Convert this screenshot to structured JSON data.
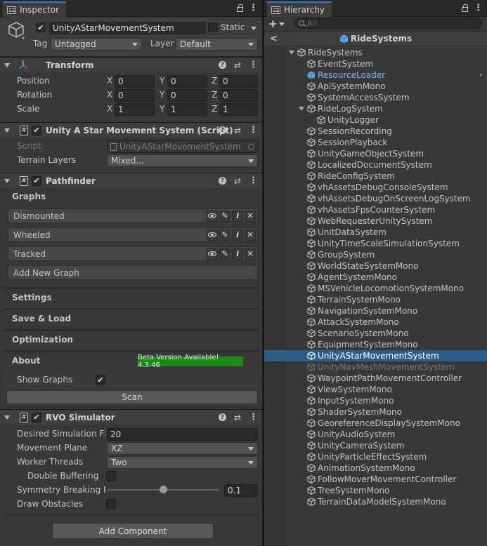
{
  "inspector": {
    "tab_label": "Inspector",
    "gameobject": {
      "name": "UnityAStarMovementSystem",
      "static_label": "Static",
      "tag_label": "Tag",
      "tag_value": "Untagged",
      "layer_label": "Layer",
      "layer_value": "Default"
    },
    "transform": {
      "title": "Transform",
      "rows": [
        {
          "label": "Position",
          "x": "0",
          "y": "0",
          "z": "0"
        },
        {
          "label": "Rotation",
          "x": "0",
          "y": "0",
          "z": "0"
        },
        {
          "label": "Scale",
          "x": "1",
          "y": "1",
          "z": "1"
        }
      ],
      "axis_x": "X",
      "axis_y": "Y",
      "axis_z": "Z"
    },
    "script_component": {
      "title": "Unity A Star Movement System (Script)",
      "script_label": "Script",
      "script_value": "UnityAStarMovementSystem",
      "terrain_label": "Terrain Layers",
      "terrain_value": "Mixed..."
    },
    "pathfinder": {
      "title": "Pathfinder",
      "graphs_label": "Graphs",
      "graphs": [
        "Dismounted",
        "Wheeled",
        "Tracked"
      ],
      "info_glyph": "i",
      "add_graph": "Add New Graph",
      "sections": [
        "Settings",
        "Save & Load",
        "Optimization",
        "About"
      ],
      "beta_badge": "Beta Version Available! 4.3.46",
      "beta_color": "#1a8a1a",
      "show_graphs_label": "Show Graphs",
      "show_graphs_checked": true,
      "scan_label": "Scan"
    },
    "rvo": {
      "title": "RVO Simulator",
      "fps_label": "Desired Simulation FPS",
      "fps_value": "20",
      "plane_label": "Movement Plane",
      "plane_value": "XZ",
      "threads_label": "Worker Threads",
      "threads_value": "Two",
      "double_buffering_label": "Double Buffering",
      "double_buffering_checked": false,
      "symmetry_label": "Symmetry Breaking Bias",
      "symmetry_value": "0.1",
      "symmetry_fraction": 0.1,
      "draw_obstacles_label": "Draw Obstacles",
      "draw_obstacles_checked": false
    },
    "add_component": "Add Component"
  },
  "hierarchy": {
    "tab_label": "Hierarchy",
    "add_label": "+",
    "search_placeholder": "All",
    "scene_title": "RideSystems",
    "accent_color": "#2c5d87",
    "items": [
      {
        "label": "RideSystems",
        "depth": 0,
        "fold": true,
        "state": "normal"
      },
      {
        "label": "EventSystem",
        "depth": 1,
        "fold": false,
        "state": "normal"
      },
      {
        "label": "ResourceLoader",
        "depth": 1,
        "fold": false,
        "state": "prefab"
      },
      {
        "label": "ApiSystemMono",
        "depth": 1,
        "fold": false,
        "state": "normal"
      },
      {
        "label": "SystemAccessSystem",
        "depth": 1,
        "fold": false,
        "state": "normal"
      },
      {
        "label": "RideLogSystem",
        "depth": 1,
        "fold": true,
        "state": "normal"
      },
      {
        "label": "UnityLogger",
        "depth": 2,
        "fold": false,
        "state": "normal"
      },
      {
        "label": "SessionRecording",
        "depth": 1,
        "fold": false,
        "state": "normal"
      },
      {
        "label": "SessionPlayback",
        "depth": 1,
        "fold": false,
        "state": "normal"
      },
      {
        "label": "UnityGameObjectSystem",
        "depth": 1,
        "fold": false,
        "state": "normal"
      },
      {
        "label": "LocalizedDocumentSystem",
        "depth": 1,
        "fold": false,
        "state": "normal"
      },
      {
        "label": "RideConfigSystem",
        "depth": 1,
        "fold": false,
        "state": "normal"
      },
      {
        "label": "vhAssetsDebugConsoleSystem",
        "depth": 1,
        "fold": false,
        "state": "normal"
      },
      {
        "label": "vhAssetsDebugOnScreenLogSystem",
        "depth": 1,
        "fold": false,
        "state": "normal"
      },
      {
        "label": "vhAssetsFpsCounterSystem",
        "depth": 1,
        "fold": false,
        "state": "normal"
      },
      {
        "label": "WebRequesterUnitySystem",
        "depth": 1,
        "fold": false,
        "state": "normal"
      },
      {
        "label": "UnitDataSystem",
        "depth": 1,
        "fold": false,
        "state": "normal"
      },
      {
        "label": "UnityTimeScaleSimulationSystem",
        "depth": 1,
        "fold": false,
        "state": "normal"
      },
      {
        "label": "GroupSystem",
        "depth": 1,
        "fold": false,
        "state": "normal"
      },
      {
        "label": "WorldStateSystemMono",
        "depth": 1,
        "fold": false,
        "state": "normal"
      },
      {
        "label": "AgentSystemMono",
        "depth": 1,
        "fold": false,
        "state": "normal"
      },
      {
        "label": "MSVehicleLocomotionSystemMono",
        "depth": 1,
        "fold": false,
        "state": "normal"
      },
      {
        "label": "TerrainSystemMono",
        "depth": 1,
        "fold": false,
        "state": "normal"
      },
      {
        "label": "NavigationSystemMono",
        "depth": 1,
        "fold": false,
        "state": "normal"
      },
      {
        "label": "AttackSystemMono",
        "depth": 1,
        "fold": false,
        "state": "normal"
      },
      {
        "label": "ScenarioSystemMono",
        "depth": 1,
        "fold": false,
        "state": "normal"
      },
      {
        "label": "EquipmentSystemMono",
        "depth": 1,
        "fold": false,
        "state": "normal"
      },
      {
        "label": "UnityAStarMovementSystem",
        "depth": 1,
        "fold": false,
        "state": "selected"
      },
      {
        "label": "UnityNavMeshMovementSystem",
        "depth": 1,
        "fold": false,
        "state": "disabled"
      },
      {
        "label": "WaypointPathMovementController",
        "depth": 1,
        "fold": false,
        "state": "normal"
      },
      {
        "label": "ViewSystemMono",
        "depth": 1,
        "fold": false,
        "state": "normal"
      },
      {
        "label": "InputSystemMono",
        "depth": 1,
        "fold": false,
        "state": "normal"
      },
      {
        "label": "ShaderSystemMono",
        "depth": 1,
        "fold": false,
        "state": "normal"
      },
      {
        "label": "GeoreferenceDisplaySystemMono",
        "depth": 1,
        "fold": false,
        "state": "normal"
      },
      {
        "label": "UnityAudioSystem",
        "depth": 1,
        "fold": false,
        "state": "normal"
      },
      {
        "label": "UnityCameraSystem",
        "depth": 1,
        "fold": false,
        "state": "normal"
      },
      {
        "label": "UnityParticleEffectSystem",
        "depth": 1,
        "fold": false,
        "state": "normal"
      },
      {
        "label": "AnimationSystemMono",
        "depth": 1,
        "fold": false,
        "state": "normal"
      },
      {
        "label": "FollowMoverMovementController",
        "depth": 1,
        "fold": false,
        "state": "normal"
      },
      {
        "label": "TreeSystemMono",
        "depth": 1,
        "fold": false,
        "state": "normal"
      },
      {
        "label": "TerrainDataModelSystemMono",
        "depth": 1,
        "fold": false,
        "state": "normal"
      }
    ]
  }
}
